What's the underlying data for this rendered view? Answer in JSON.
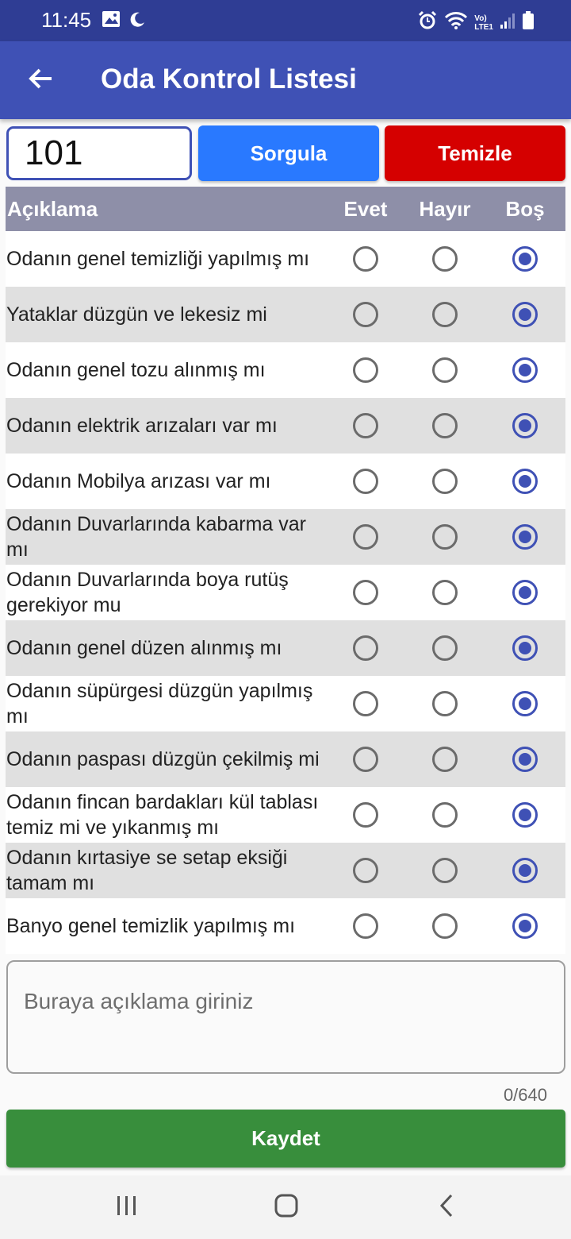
{
  "status_bar": {
    "time": "11:45",
    "lte_top": "Vo)",
    "lte_bottom": "LTE1"
  },
  "appbar": {
    "title": "Oda Kontrol Listesi"
  },
  "room": {
    "value": "101"
  },
  "buttons": {
    "query": "Sorgula",
    "clear": "Temizle",
    "save": "Kaydet"
  },
  "table": {
    "headers": {
      "description": "Açıklama",
      "yes": "Evet",
      "no": "Hayır",
      "empty": "Boş"
    },
    "rows": [
      {
        "question": "Odanın genel temizliği yapılmış mı",
        "selected": "Boş"
      },
      {
        "question": "Yataklar düzgün ve lekesiz mi",
        "selected": "Boş"
      },
      {
        "question": "Odanın genel tozu alınmış mı",
        "selected": "Boş"
      },
      {
        "question": "Odanın elektrik arızaları var mı",
        "selected": "Boş"
      },
      {
        "question": "Odanın Mobilya arızası var mı",
        "selected": "Boş"
      },
      {
        "question": "Odanın Duvarlarında kabarma var mı",
        "selected": "Boş"
      },
      {
        "question": "Odanın Duvarlarında boya rutüş gerekiyor mu",
        "selected": "Boş"
      },
      {
        "question": "Odanın genel düzen alınmış mı",
        "selected": "Boş"
      },
      {
        "question": "Odanın süpürgesi düzgün yapılmış mı",
        "selected": "Boş"
      },
      {
        "question": "Odanın paspası düzgün çekilmiş mi",
        "selected": "Boş"
      },
      {
        "question": "Odanın fincan bardakları kül tablası temiz mi ve yıkanmış mı",
        "selected": "Boş"
      },
      {
        "question": "Odanın kırtasiye se setap eksiği tamam mı",
        "selected": "Boş"
      },
      {
        "question": "Banyo genel temizlik yapılmış mı",
        "selected": "Boş"
      }
    ]
  },
  "note": {
    "placeholder": "Buraya açıklama giriniz",
    "counter": "0/640"
  },
  "colors": {
    "primary": "#3f51b5",
    "status_bar": "#2f3d94",
    "query": "#2979ff",
    "clear": "#d50000",
    "save": "#388e3c",
    "header_row": "#8e8fa8"
  },
  "icons": {
    "back": "arrow-left-icon",
    "status": [
      "image-icon",
      "moon-icon",
      "alarm-icon",
      "wifi-icon",
      "signal-icon",
      "battery-icon"
    ],
    "nav": [
      "recent-apps-icon",
      "home-icon",
      "back-chevron-icon"
    ]
  }
}
